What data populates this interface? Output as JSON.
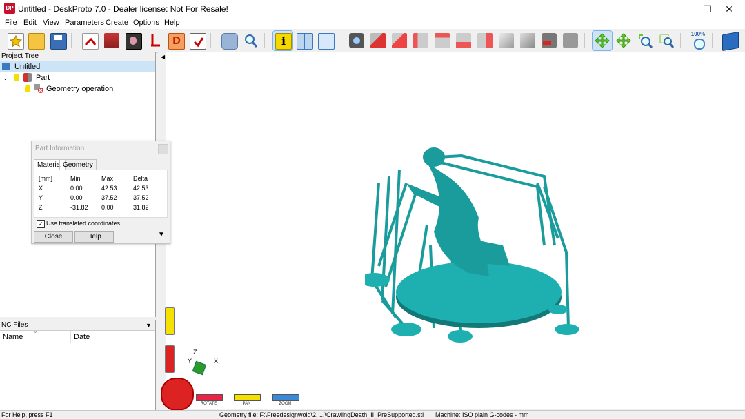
{
  "window": {
    "app_icon": "DP",
    "title": "Untitled - DeskProto 7.0 - Dealer license: Not For Resale!",
    "minimize": "—",
    "maximize": "☐",
    "close": "✕"
  },
  "menu": [
    "File",
    "Edit",
    "View",
    "Parameters",
    "Create",
    "Options",
    "Help"
  ],
  "toolbar": {
    "zoom_label": "100%",
    "icons": [
      "new-project-icon",
      "open-folder-icon",
      "save-icon",
      "import-geometry-icon",
      "add-part-icon",
      "bitmap-icon",
      "vector-icon",
      "drawing-icon",
      "save-nc-icon",
      "print-preview-icon",
      "search-icon",
      "info-icon",
      "layout-icon",
      "view-window-icon",
      "camera-icon",
      "view-front-icon",
      "view-top-icon",
      "view-left-icon",
      "view-back-icon",
      "view-bottom-icon",
      "view-right-icon",
      "view-iso-icon",
      "view-iso-2-icon",
      "render-icon",
      "render-2-icon",
      "rotate-mode-icon",
      "pan-mode-icon",
      "zoom-mode-icon",
      "zoom-window-icon",
      "zoom-100-icon",
      "help-book-icon"
    ],
    "accent_blue": "#5b9bd5"
  },
  "project_tree": {
    "header": "Project Tree",
    "root": "Untitled",
    "part": "Part",
    "operation": "Geometry operation"
  },
  "nc_files": {
    "header": "NC Files",
    "col_name": "Name",
    "col_date": "Date"
  },
  "part_info": {
    "title": "Part Information",
    "tab_material": "Material",
    "tab_geometry": "Geometry",
    "headers": [
      "[mm]",
      "Min",
      "Max",
      "Delta"
    ],
    "rows": [
      [
        "X",
        "0.00",
        "42.53",
        "42.53"
      ],
      [
        "Y",
        "0.00",
        "37.52",
        "37.52"
      ],
      [
        "Z",
        "-31.82",
        "0.00",
        "31.82"
      ]
    ],
    "checkbox_label": "Use translated coordinates",
    "checkbox_checked": true,
    "close_btn": "Close",
    "help_btn": "Help"
  },
  "viewport": {
    "model_color": "#1a9c9c",
    "axes": {
      "x": "X",
      "y": "Y",
      "z": "Z"
    },
    "controls": {
      "rotate": "ROTATE",
      "pan": "PAN",
      "zoom": "ZOOM"
    }
  },
  "status": {
    "help": "For Help, press F1",
    "geometry_file": "Geometry file: F:\\Freedesignwold\\2, ...\\CrawlingDeath_II_PreSupported.stl",
    "machine": "Machine: ISO plain G-codes - mm"
  }
}
